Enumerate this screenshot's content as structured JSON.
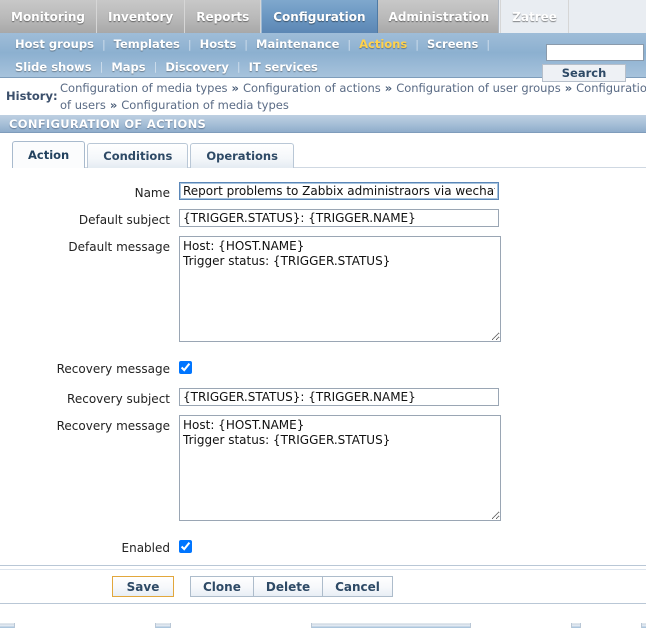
{
  "topmenu": {
    "items": [
      {
        "label": "Monitoring",
        "active": false
      },
      {
        "label": "Inventory",
        "active": false
      },
      {
        "label": "Reports",
        "active": false
      },
      {
        "label": "Configuration",
        "active": true
      },
      {
        "label": "Administration",
        "active": false
      },
      {
        "label": "Zatree",
        "active": false
      }
    ]
  },
  "submenu": {
    "row1": [
      {
        "label": "Host groups",
        "highlight": false
      },
      {
        "label": "Templates",
        "highlight": false
      },
      {
        "label": "Hosts",
        "highlight": false
      },
      {
        "label": "Maintenance",
        "highlight": false
      },
      {
        "label": "Actions",
        "highlight": true
      },
      {
        "label": "Screens",
        "highlight": false
      }
    ],
    "row2": [
      {
        "label": "Slide shows",
        "highlight": false
      },
      {
        "label": "Maps",
        "highlight": false
      },
      {
        "label": "Discovery",
        "highlight": false
      },
      {
        "label": "IT services",
        "highlight": false
      }
    ],
    "separator": "|"
  },
  "search": {
    "value": "",
    "placeholder": "",
    "button_label": "Search"
  },
  "history": {
    "label": "History:",
    "crumbs": [
      "Configuration of media types",
      "Configuration of actions",
      "Configuration of user groups",
      "Configuration of users",
      "Configuration of media types"
    ],
    "separator": "»"
  },
  "page": {
    "title": "CONFIGURATION OF ACTIONS"
  },
  "tabs": [
    {
      "label": "Action",
      "active": true
    },
    {
      "label": "Conditions",
      "active": false
    },
    {
      "label": "Operations",
      "active": false
    }
  ],
  "form": {
    "name": {
      "label": "Name",
      "value": "Report problems to Zabbix administraors via wechat",
      "placeholder": ""
    },
    "default_subject": {
      "label": "Default subject",
      "value": "{TRIGGER.STATUS}: {TRIGGER.NAME}",
      "placeholder": ""
    },
    "default_message": {
      "label": "Default message",
      "value": "Host: {HOST.NAME}\nTrigger status: {TRIGGER.STATUS}",
      "placeholder": ""
    },
    "recovery_message_toggle": {
      "label": "Recovery message",
      "checked": true
    },
    "recovery_subject": {
      "label": "Recovery subject",
      "value": "{TRIGGER.STATUS}: {TRIGGER.NAME}",
      "placeholder": ""
    },
    "recovery_message": {
      "label": "Recovery message",
      "value": "Host: {HOST.NAME}\nTrigger status: {TRIGGER.STATUS}",
      "placeholder": ""
    },
    "enabled": {
      "label": "Enabled",
      "checked": true
    }
  },
  "footer": {
    "buttons": [
      {
        "label": "Save",
        "primary": true
      },
      {
        "label": "Clone",
        "primary": false
      },
      {
        "label": "Delete",
        "primary": false
      },
      {
        "label": "Cancel",
        "primary": false
      }
    ]
  },
  "colors": {
    "accent_blue": "#5c87b4",
    "submenu_blue": "#8cb0d0",
    "highlight_gold": "#ffd24d",
    "primary_border": "#e2a73c",
    "title_text": "#ffffff"
  }
}
